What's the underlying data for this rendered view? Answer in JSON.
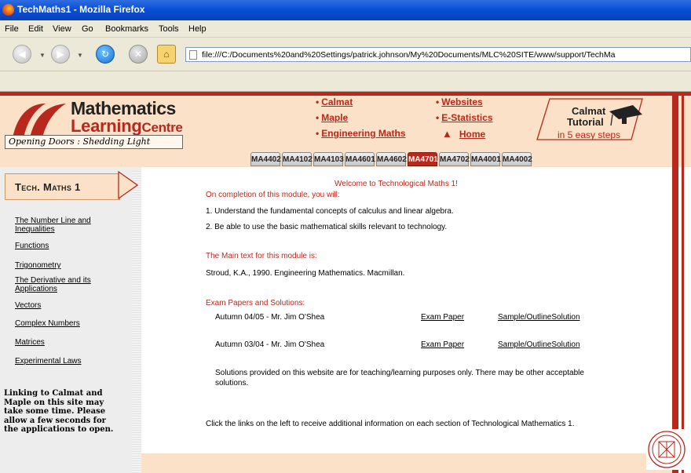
{
  "window": {
    "title": "TechMaths1 - Mozilla Firefox"
  },
  "menu": [
    "File",
    "Edit",
    "View",
    "Go",
    "Bookmarks",
    "Tools",
    "Help"
  ],
  "address_bar": {
    "url": "file:///C:/Documents%20and%20Settings/patrick.johnson/My%20Documents/MLC%20SITE/www/support/TechMa"
  },
  "toolbar_icons": [
    "back-icon",
    "forward-icon",
    "reload-icon",
    "stop-icon",
    "home-icon",
    "page-icon"
  ],
  "site_header": {
    "logo_line1": "Mathematics",
    "logo_line2_main": "Learning",
    "logo_line2_small": "Centre",
    "tagline": "Opening Doors : Shedding Light",
    "links": [
      {
        "label": "Calmat"
      },
      {
        "label": "Maple"
      },
      {
        "label": "Engineering Maths"
      },
      {
        "label": "Websites"
      },
      {
        "label": "E-Statistics"
      },
      {
        "label": "Home"
      }
    ],
    "calmat_tutorial": {
      "line1": "Calmat",
      "line2": "Tutorial",
      "line3": "in 5 easy steps"
    },
    "tabs": [
      "MA4402",
      "MA4102",
      "MA4103",
      "MA4601",
      "MA4602",
      "MA4701",
      "MA4702",
      "MA4001",
      "MA4002"
    ],
    "active_tab": "MA4701"
  },
  "sidebar": {
    "title": "Tech. Maths 1",
    "items": [
      {
        "label": "The Number Line and Inequalities"
      },
      {
        "label": "Functions"
      },
      {
        "label": "Trigonometry"
      },
      {
        "label": "The Derivative and its Applications"
      },
      {
        "label": "Vectors"
      },
      {
        "label": "Complex Numbers"
      },
      {
        "label": "Matrices"
      },
      {
        "label": "Experimental Laws"
      }
    ],
    "note": "Linking to Calmat and Maple on this site may take some time. Please allow a few seconds for the applications to open."
  },
  "main": {
    "welcome": "Welcome to Technological Maths 1!",
    "intro": "On completion of this module, you will:",
    "objective1": "1. Understand the fundamental concepts of calculus and linear algebra.",
    "objective2": "2. Be able to use the basic mathematical skills relevant to technology.",
    "text_heading": "The Main text for this module is:",
    "text_ref": "Stroud, K.A., 1990. Engineering Mathematics. Macmillan.",
    "exam_heading": "Exam Papers and Solutions:",
    "exams": [
      {
        "term": "Autumn 04/05 - Mr. Jim O'Shea",
        "paper": "Exam Paper",
        "solution": "Sample/OutlineSolution"
      },
      {
        "term": "Autumn 03/04 - Mr. Jim O'Shea",
        "paper": "Exam Paper",
        "solution": "Sample/OutlineSolution"
      }
    ],
    "disclaimer": "Solutions provided on this website are for teaching/learning purposes only. There may be other acceptable solutions.",
    "footer_note": "Click the links on the left to receive additional information on each section of Technological Mathematics 1."
  },
  "colors": {
    "accent_red": "#b9281d",
    "header_peach": "#fbe1c7",
    "sidebar_gray": "#ededed",
    "titlebar_blue": "#0a4fd6"
  }
}
